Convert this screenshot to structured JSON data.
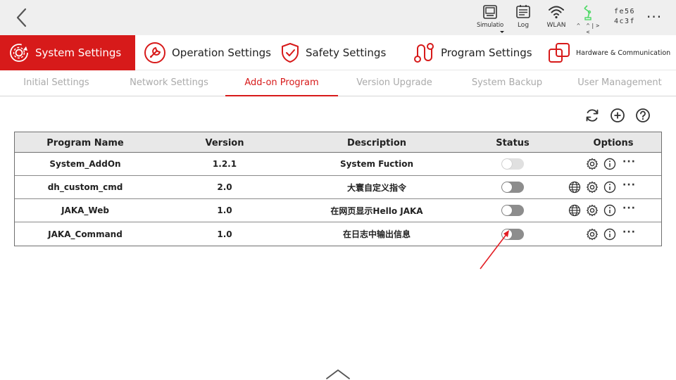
{
  "topbar": {
    "back_icon": "chevron-left-icon",
    "simulation_label": "Simulatio",
    "log_label": "Log",
    "wlan_label": "WLAN",
    "robot_status_label": "^ ^|> <",
    "device_id_line1": "fe56",
    "device_id_line2": "4c3f",
    "more_label": "···"
  },
  "main_tabs": [
    {
      "label": "System Settings",
      "icon": "gear-refresh-icon",
      "active": true
    },
    {
      "label": "Operation Settings",
      "icon": "wrench-icon",
      "active": false
    },
    {
      "label": "Safety Settings",
      "icon": "shield-check-icon",
      "active": false
    },
    {
      "label": "Program Settings",
      "icon": "program-path-icon",
      "active": false
    },
    {
      "label": "Hardware & Communication",
      "icon": "hardware-icon",
      "active": false
    }
  ],
  "sub_tabs": [
    {
      "label": "Initial Settings",
      "active": false
    },
    {
      "label": "Network Settings",
      "active": false
    },
    {
      "label": "Add-on Program",
      "active": true
    },
    {
      "label": "Version Upgrade",
      "active": false
    },
    {
      "label": "System Backup",
      "active": false
    },
    {
      "label": "User Management",
      "active": false
    }
  ],
  "toolbar": {
    "refresh_icon": "refresh-icon",
    "add_icon": "add-circle-icon",
    "help_icon": "help-icon"
  },
  "table": {
    "headers": [
      "Program Name",
      "Version",
      "Description",
      "Status",
      "Options"
    ],
    "rows": [
      {
        "name": "System_AddOn",
        "version": "1.2.1",
        "description": "System Fuction",
        "status_enabled": false,
        "status_disabled": true,
        "web": false
      },
      {
        "name": "dh_custom_cmd",
        "version": "2.0",
        "description": "大寰自定义指令",
        "status_enabled": false,
        "status_disabled": false,
        "web": true
      },
      {
        "name": "JAKA_Web",
        "version": "1.0",
        "description": "在网页显示Hello JAKA",
        "status_enabled": false,
        "status_disabled": false,
        "web": true
      },
      {
        "name": "JAKA_Command",
        "version": "1.0",
        "description": "在日志中输出信息",
        "status_enabled": false,
        "status_disabled": false,
        "web": false
      }
    ],
    "more_label": "···"
  },
  "colors": {
    "accent": "#d71a1a",
    "topbar_bg": "#efefef",
    "header_bg": "#e8e8e8",
    "annotation": "#e31e24",
    "robot_green": "#4cd964"
  }
}
